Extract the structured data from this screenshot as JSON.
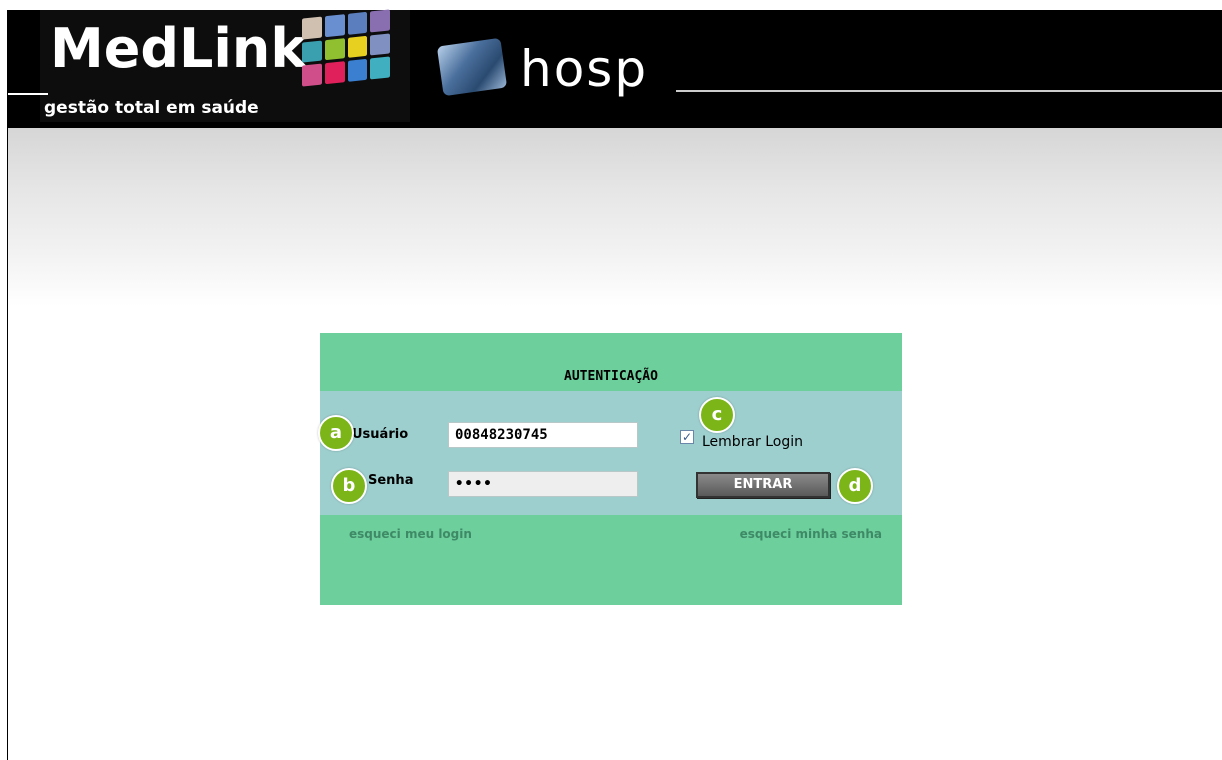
{
  "header": {
    "logo_text": "MedLink",
    "logo_tagline": "gestão total em saúde",
    "module_name": "hosp",
    "grid_colors": [
      "#d0c0b0",
      "#6a8fd0",
      "#5b7fbe",
      "#8a6fb0",
      "#3aa0b0",
      "#90c030",
      "#e8d020",
      "#8090c0",
      "#d04f8a",
      "#e0205a",
      "#3a7fd0",
      "#40b0c0"
    ]
  },
  "panel": {
    "title": "AUTENTICAÇÃO",
    "username_label": "Usuário",
    "username_value": "00848230745",
    "password_label": "Senha",
    "password_display": "••••",
    "remember_label": "Lembrar Login",
    "remember_checked": true,
    "remember_mark": "✓",
    "submit_label": "ENTRAR",
    "forgot_login": "esqueci meu login",
    "forgot_password": "esqueci minha senha"
  },
  "annotations": {
    "a": "a",
    "b": "b",
    "c": "c",
    "d": "d"
  },
  "colors": {
    "header_bg": "#000000",
    "panel_green": "#6ccf9c",
    "panel_body": "#9ecfcf",
    "badge_green": "#7cb518"
  }
}
